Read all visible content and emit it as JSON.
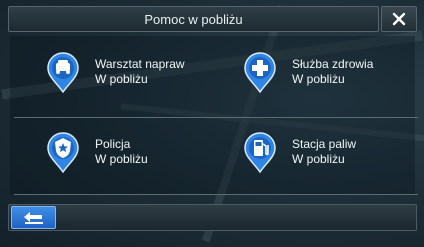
{
  "header": {
    "title": "Pomoc w pobliżu"
  },
  "items": [
    {
      "name": "Warsztat napraw",
      "sub": "W pobliżu",
      "icon": "car-repair-icon"
    },
    {
      "name": "Służba zdrowia",
      "sub": "W pobliżu",
      "icon": "medical-cross-icon"
    },
    {
      "name": "Policja",
      "sub": "W pobliżu",
      "icon": "police-badge-icon"
    },
    {
      "name": "Stacja paliw",
      "sub": "W pobliżu",
      "icon": "fuel-pump-icon"
    }
  ],
  "colors": {
    "accent": "#2b7fe0",
    "pin": "#2f85e6",
    "background": "#1b2a33"
  },
  "controls": {
    "back_icon": "back-arrow-icon",
    "close_icon": "close-icon"
  }
}
